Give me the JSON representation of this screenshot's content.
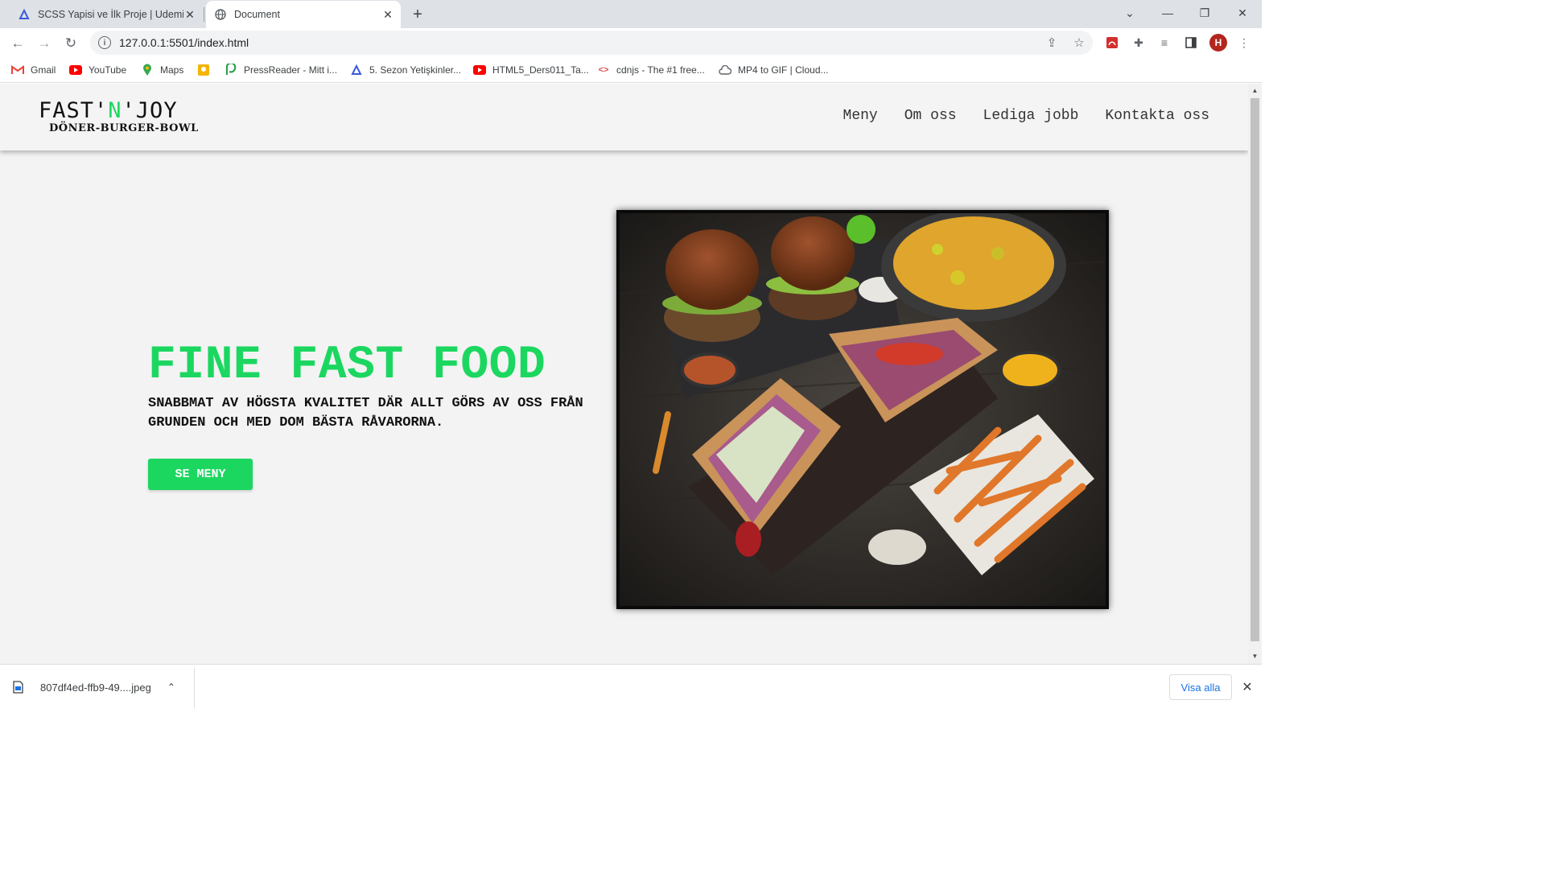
{
  "browser": {
    "tabs": [
      {
        "title": "SCSS Yapisi ve İlk Proje | Udemig",
        "favicon": "udemig-icon",
        "active": false
      },
      {
        "title": "Document",
        "favicon": "globe-icon",
        "active": true
      }
    ],
    "new_tab_label": "+",
    "url": "127.0.0.1:5501/index.html",
    "profile_initial": "H",
    "bookmarks": [
      {
        "label": "Gmail",
        "icon": "gmail-icon"
      },
      {
        "label": "YouTube",
        "icon": "youtube-icon"
      },
      {
        "label": "Maps",
        "icon": "maps-icon"
      },
      {
        "label": "",
        "icon": "bookmark-app-icon"
      },
      {
        "label": "PressReader - Mitt i...",
        "icon": "pressreader-icon"
      },
      {
        "label": "5. Sezon Yetişkinler...",
        "icon": "udemig-icon"
      },
      {
        "label": "HTML5_Ders011_Ta...",
        "icon": "youtube-icon"
      },
      {
        "label": "cdnjs - The #1 free...",
        "icon": "code-icon"
      },
      {
        "label": "MP4 to GIF | Cloud...",
        "icon": "cloud-icon"
      }
    ]
  },
  "site": {
    "logo_main_a": "FAST'",
    "logo_main_b": "N",
    "logo_main_c": "'JOY",
    "logo_sub": "DÖNER-BURGER-BOWL",
    "nav": [
      "Meny",
      "Om oss",
      "Lediga jobb",
      "Kontakta oss"
    ],
    "hero": {
      "title": "FINE FAST FOOD",
      "subtitle": "SNABBMAT AV HÖGSTA KVALITET DÄR ALLT GÖRS AV OSS FRÅN GRUNDEN OCH MED DOM BÄSTA RÅVARORNA.",
      "cta": "SE MENY"
    }
  },
  "download": {
    "file": "807df4ed-ffb9-49....jpeg",
    "show_all": "Visa alla"
  },
  "colors": {
    "accent": "#1bd760",
    "page_bg": "#f3f3f3",
    "text": "#111111"
  }
}
